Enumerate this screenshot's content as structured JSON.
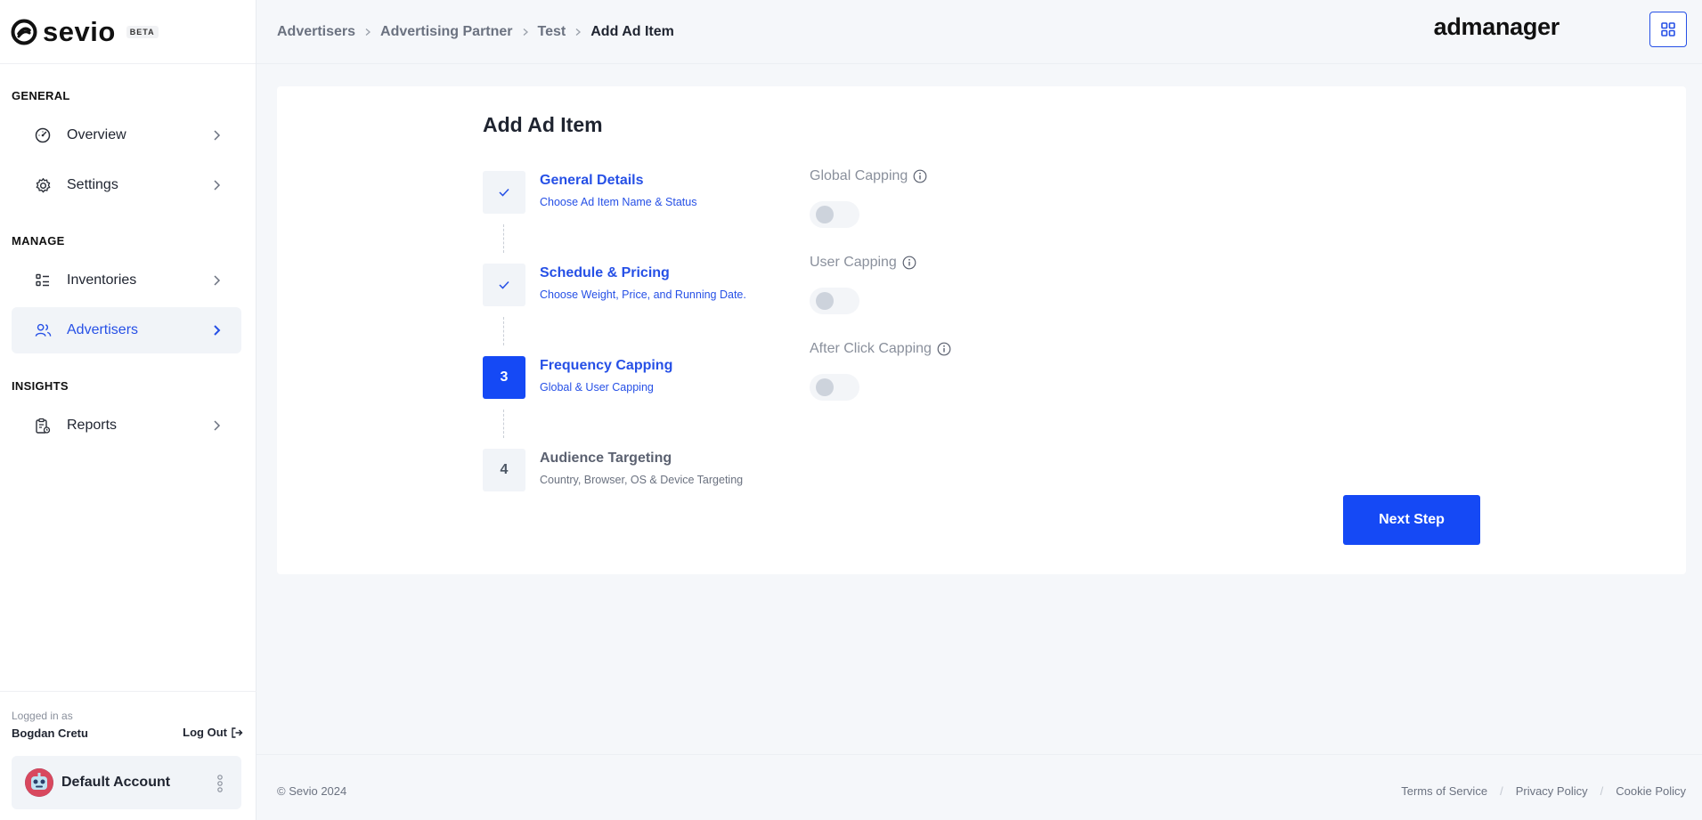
{
  "brand": {
    "name": "sevio",
    "badge": "BETA",
    "product": "admanager"
  },
  "sidebar": {
    "sections": [
      {
        "title": "GENERAL"
      },
      {
        "title": "MANAGE"
      },
      {
        "title": "INSIGHTS"
      }
    ],
    "items": [
      {
        "label": "Overview",
        "icon": "gauge-icon"
      },
      {
        "label": "Settings",
        "icon": "gear-icon"
      },
      {
        "label": "Inventories",
        "icon": "list-icon"
      },
      {
        "label": "Advertisers",
        "icon": "users-icon",
        "active": true
      },
      {
        "label": "Reports",
        "icon": "report-icon"
      }
    ],
    "footer": {
      "logged_in_label": "Logged in as",
      "user_name": "Bogdan Cretu",
      "logout_label": "Log Out",
      "account_name": "Default Account"
    }
  },
  "header": {
    "breadcrumb": [
      "Advertisers",
      "Advertising Partner",
      "Test",
      "Add Ad Item"
    ]
  },
  "main": {
    "title": "Add Ad Item",
    "steps": [
      {
        "marker": "",
        "state": "done",
        "title": "General Details",
        "subtitle": "Choose Ad Item Name & Status"
      },
      {
        "marker": "",
        "state": "done",
        "title": "Schedule & Pricing",
        "subtitle": "Choose Weight, Price, and Running Date."
      },
      {
        "marker": "3",
        "state": "active",
        "title": "Frequency Capping",
        "subtitle": "Global & User Capping"
      },
      {
        "marker": "4",
        "state": "pending",
        "title": "Audience Targeting",
        "subtitle": "Country, Browser, OS & Device Targeting"
      }
    ],
    "capping": [
      {
        "label": "Global Capping",
        "enabled": false
      },
      {
        "label": "User Capping",
        "enabled": false
      },
      {
        "label": "After Click Capping",
        "enabled": false
      }
    ],
    "next_button": "Next Step"
  },
  "footer": {
    "copyright": "© Sevio 2024",
    "links": [
      "Terms of Service",
      "Privacy Policy",
      "Cookie Policy"
    ]
  },
  "colors": {
    "accent": "#1549f5",
    "link": "#2650e6"
  }
}
